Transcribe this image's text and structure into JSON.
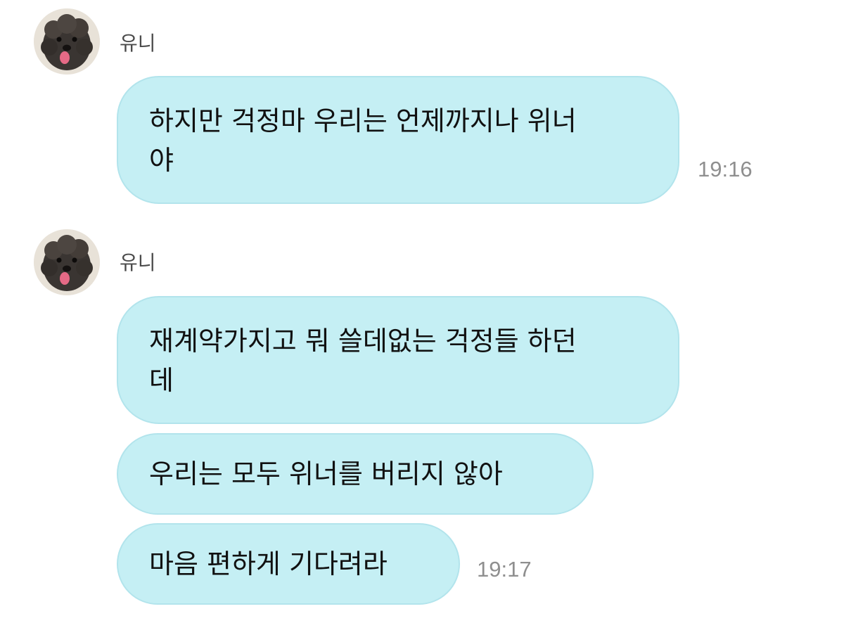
{
  "messages": [
    {
      "sender": "유니",
      "bubbles": [
        {
          "lines": [
            "하지만 걱정마 우리는 언제까지나 위너",
            "야"
          ]
        }
      ],
      "time": "19:16"
    },
    {
      "sender": "유니",
      "bubbles": [
        {
          "lines": [
            "재계약가지고 뭐 쓸데없는 걱정들 하던",
            "데"
          ]
        },
        {
          "lines": [
            "우리는 모두 위너를 버리지 않아"
          ]
        },
        {
          "lines": [
            "마음 편하게 기다려라"
          ]
        }
      ],
      "time": "19:17"
    }
  ],
  "icons": {
    "avatar": "dog-avatar-icon"
  },
  "colors": {
    "bubble": "#c5eff4",
    "bubble_border": "#b2e4ec",
    "text": "#111111",
    "sender": "#4a4a4a",
    "time": "#8f8f8f"
  }
}
